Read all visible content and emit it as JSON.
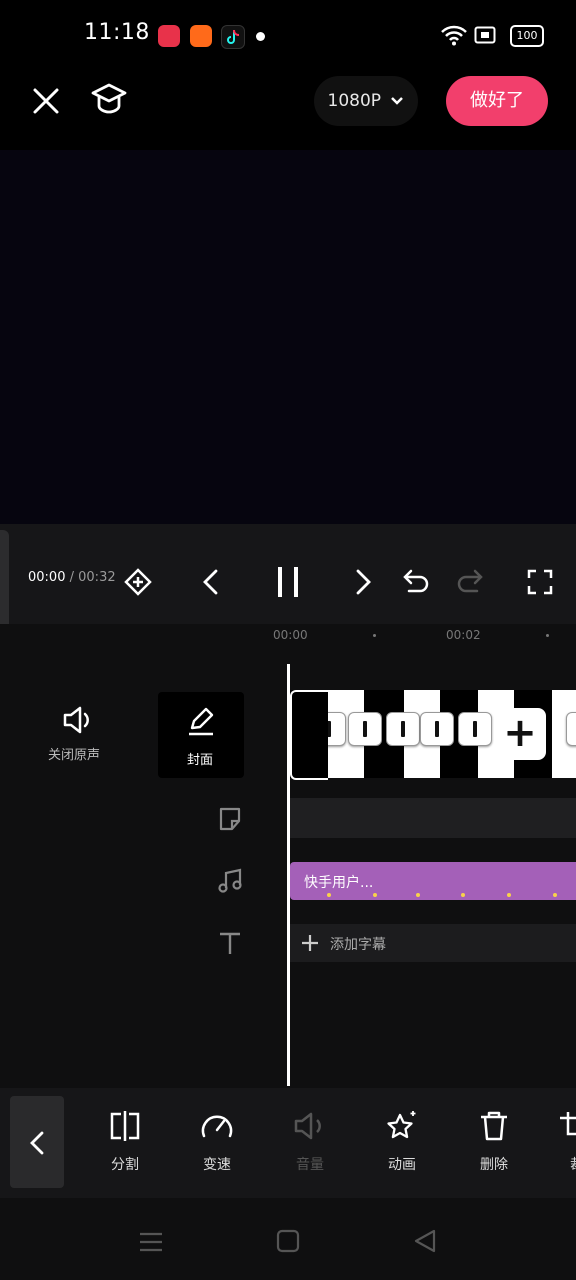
{
  "status_bar": {
    "time": "11:18",
    "battery": "100"
  },
  "top_bar": {
    "resolution": "1080P",
    "done_label": "做好了"
  },
  "playback": {
    "current_time": "00:00",
    "separator": "/",
    "total_time": "00:32"
  },
  "ruler": {
    "tick_1": "00:00",
    "tick_2": "00:02"
  },
  "side": {
    "mute_label": "关闭原声",
    "cover_label": "封面"
  },
  "tracks": {
    "audio_label": "快手用户...",
    "add_subtitle_label": "添加字幕"
  },
  "toolbar": {
    "items": [
      {
        "label": "分割",
        "icon": "split-icon"
      },
      {
        "label": "变速",
        "icon": "speed-icon"
      },
      {
        "label": "音量",
        "icon": "volume-icon"
      },
      {
        "label": "动画",
        "icon": "animation-icon"
      },
      {
        "label": "删除",
        "icon": "delete-icon"
      },
      {
        "label": "裁",
        "icon": "crop-icon"
      }
    ]
  },
  "colors": {
    "accent": "#f23f6c",
    "audio_track": "#a460b8",
    "background": "#0f0f10"
  }
}
